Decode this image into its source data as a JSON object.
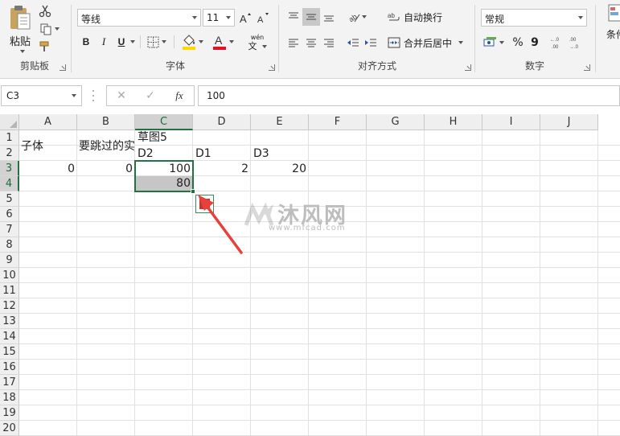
{
  "ribbon": {
    "clipboard": {
      "paste_label": "粘贴",
      "group_label": "剪贴板"
    },
    "font": {
      "font_name": "等线",
      "font_size": "11",
      "bold": "B",
      "italic": "I",
      "underline": "U",
      "font_color_glyph": "A",
      "phonetic_glyph_top": "wén",
      "phonetic_glyph_bottom": "文",
      "group_label": "字体"
    },
    "alignment": {
      "wrap_text": "自动换行",
      "merge_center": "合并后居中",
      "group_label": "对齐方式"
    },
    "number": {
      "format": "常规",
      "percent": "%",
      "comma": "9",
      "group_label": "数字"
    },
    "styles": {
      "conditional_partial": "条件"
    }
  },
  "formula_bar": {
    "name_box": "C3",
    "cancel_glyph": "✕",
    "enter_glyph": "✓",
    "fx_glyph": "fx",
    "formula": "100"
  },
  "grid": {
    "columns": [
      "A",
      "B",
      "C",
      "D",
      "E",
      "F",
      "G",
      "H",
      "I",
      "J"
    ],
    "rows": [
      "1",
      "2",
      "3",
      "4",
      "5",
      "6",
      "7",
      "8",
      "9",
      "10",
      "11",
      "12",
      "13",
      "14",
      "15",
      "16",
      "17",
      "18",
      "19",
      "20"
    ],
    "cells": {
      "A1": "子体",
      "B1": "要跳过的实",
      "A3": "0",
      "B3": "0",
      "C3": "100",
      "D3": "2",
      "E3": "20",
      "C4": "80"
    },
    "floating_labels": {
      "sketch": "草图5",
      "d2": "D2",
      "d1": "D1",
      "d3": "D3"
    }
  },
  "watermark": {
    "brand": "沐风网",
    "url": "www.mfcad.com"
  },
  "colors": {
    "accent_green": "#217346",
    "arrow_red": "#e8403a",
    "font_color_red": "#e81123",
    "fill_yellow": "#ffd800"
  },
  "icons": [
    "clipboard-icon",
    "cut-icon",
    "copy-icon",
    "format-painter-icon",
    "grow-font-icon",
    "shrink-font-icon",
    "border-icon",
    "fill-color-icon",
    "font-color-icon",
    "phonetic-icon",
    "align-top-icon",
    "align-middle-icon",
    "align-bottom-icon",
    "align-left-icon",
    "align-center-icon",
    "align-right-icon",
    "orientation-icon",
    "decrease-indent-icon",
    "increase-indent-icon",
    "wrap-text-icon",
    "merge-icon",
    "accounting-icon",
    "increase-decimal-icon",
    "decrease-decimal-icon",
    "conditional-format-icon"
  ]
}
